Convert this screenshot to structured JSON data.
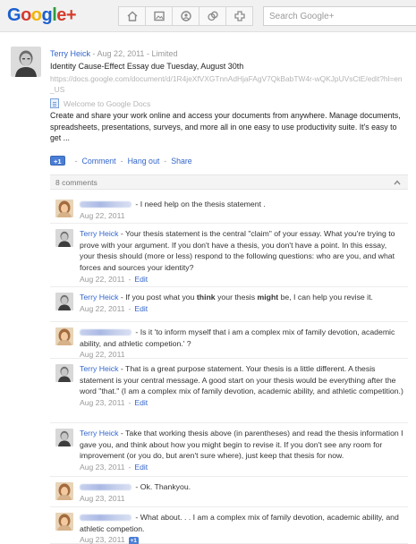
{
  "app": {
    "logo_text": "Google+",
    "logo_colors": [
      "#1a5fd0",
      "#d63c2c",
      "#f2b406",
      "#1a5fd0",
      "#2e9d3e",
      "#d63c2c",
      "#d63c2c"
    ],
    "search_placeholder": "Search Google+"
  },
  "nav": {
    "icons": [
      "home-icon",
      "photos-icon",
      "profile-icon",
      "circles-icon",
      "games-icon"
    ]
  },
  "post": {
    "author": "Terry Heick",
    "dash": "-",
    "date": "Aug 22, 2011",
    "visibility": "Limited",
    "title": "Identity Cause-Effect Essay due Tuesday, August 30th",
    "url": "https://docs.google.com/document/d/1R4jeXfVXGTnnAdHjaFAgV7QkBabTW4r-wQKJpUVsCtE/edit?hl=en_US",
    "docs_title": "Welcome to Google Docs",
    "description": "Create and share your work online and access your documents from anywhere. Manage documents, spreadsheets, presentations, surveys, and more all in one easy to use productivity suite. It's easy to get ...",
    "actions": {
      "plus_one": "+1",
      "sep": "-",
      "comment": "Comment",
      "hangout": "Hang out",
      "share": "Share"
    }
  },
  "comments": {
    "count_label": "8 comments",
    "items": [
      {
        "author": "",
        "dash": "-",
        "text": "I need help on the thesis statement .",
        "date": "Aug 22, 2011",
        "edit": ""
      },
      {
        "author": "Terry Heick",
        "dash": "-",
        "text": "Your thesis statement is the central \"claim\" of your essay. What you're trying to prove with your argument. If you don't have a thesis, you don't have a point. In this essay, your thesis should (more or less) respond to the following questions: who are you, and what forces and sources your identity?",
        "date": "Aug 22, 2011",
        "edit": "Edit"
      },
      {
        "author": "Terry Heick",
        "dash": "-",
        "text_a": "If you post what you ",
        "text_b": "think",
        "text_c": " your thesis ",
        "text_d": "might",
        "text_e": " be, I can help you revise it.",
        "date": "Aug 22, 2011",
        "edit": "Edit"
      },
      {
        "author": "",
        "dash": "-",
        "text": "Is it 'to inform myself that i am a complex mix of family devotion, academic ability, and athletic competion.' ?",
        "date": "Aug 22, 2011",
        "edit": ""
      },
      {
        "author": "Terry Heick",
        "dash": "-",
        "text": "That is a great purpose statement. Your thesis is a little different. A thesis statement is your central message. A good start on your thesis would be everything after the word \"that.\" (I am a complex mix of family devotion, academic ability, and athletic competition.)",
        "date": "Aug 23, 2011",
        "edit": "Edit"
      },
      {
        "author": "Terry Heick",
        "dash": "-",
        "text": "Take that working thesis above (in parentheses) and read the thesis information I gave you, and think about how you might begin to revise it. If you don't see any room for improvement (or you do, but aren't sure where), just keep that thesis for now.",
        "date": "Aug 23, 2011",
        "edit": "Edit"
      },
      {
        "author": "",
        "dash": "-",
        "text": "Ok. Thankyou.",
        "date": "Aug 23, 2011",
        "edit": ""
      },
      {
        "author": "",
        "dash": "-",
        "text": "What about. . . I am a complex mix of family devotion, academic ability, and athletic competion.",
        "date": "Aug 23, 2011",
        "edit": "",
        "plus_one": "+1"
      }
    ]
  }
}
